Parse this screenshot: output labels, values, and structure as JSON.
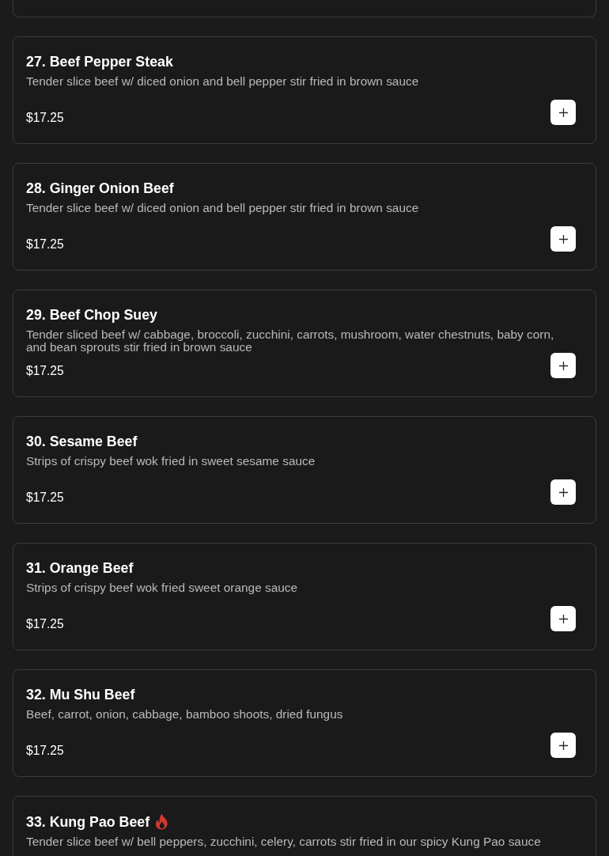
{
  "items": [
    {
      "title": "27. Beef Pepper Steak",
      "description": "Tender slice beef w/ diced onion and bell pepper stir fried in brown sauce",
      "price": "$17.25",
      "spicy": false
    },
    {
      "title": "28. Ginger Onion Beef",
      "description": "Tender slice beef w/ diced onion and bell pepper stir fried in brown sauce",
      "price": "$17.25",
      "spicy": false
    },
    {
      "title": "29. Beef Chop Suey",
      "description": "Tender sliced beef w/ cabbage, broccoli, zucchini, carrots, mushroom, water chestnuts, baby corn, and bean sprouts stir fried in brown sauce",
      "price": "$17.25",
      "spicy": false
    },
    {
      "title": "30. Sesame Beef",
      "description": "Strips of crispy beef wok fried in sweet sesame sauce",
      "price": "$17.25",
      "spicy": false
    },
    {
      "title": "31. Orange Beef",
      "description": "Strips of crispy beef wok fried sweet orange sauce",
      "price": "$17.25",
      "spicy": false
    },
    {
      "title": "32. Mu Shu Beef",
      "description": "Beef, carrot, onion, cabbage, bamboo shoots, dried fungus",
      "price": "$17.25",
      "spicy": false
    },
    {
      "title": "33. Kung Pao Beef",
      "description": "Tender slice beef w/ bell peppers, zucchini, celery, carrots stir fried in our spicy Kung Pao sauce",
      "spicy": true
    }
  ]
}
